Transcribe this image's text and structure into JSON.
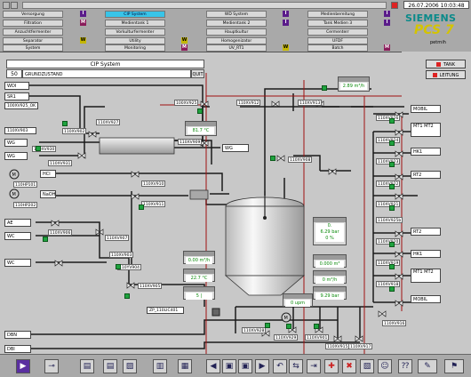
{
  "nav": {
    "rows": [
      [
        "Versorgung",
        "CIP System",
        "WD System",
        "Medienbereitung"
      ],
      [
        "Filtration",
        "Medientank 1",
        "Medientank 2",
        "Tank Medien 3"
      ],
      [
        "Anzuchtfermenter",
        "Vorkulturfermenter",
        "Hauptkultur",
        "Cermenterr"
      ],
      [
        "Separator",
        "Utility",
        "Homogenizator",
        "UFDF"
      ],
      [
        "System",
        "Monitoring",
        "UV_RT1",
        "Batch"
      ]
    ]
  },
  "header": {
    "datetime": "26.07.2006 10:03:48",
    "brand": "SIEMENS",
    "product": "PCS 7",
    "user": "petrnih"
  },
  "title": "CIP System",
  "state": {
    "num": "50",
    "text": "GRUNDZUSTAND",
    "quit": "QUIT"
  },
  "buttons": {
    "tank": "TANK",
    "leitung": "LEITUNG"
  },
  "left_tags": {
    "wdi": "WDI",
    "sr1": "SR1",
    "valve_ok": "100XV925_OK",
    "v903": "110XV903",
    "wg1": "WG",
    "wg2": "WG",
    "hcl": "HCl",
    "naoh": "NaOH",
    "ae": "AE",
    "wc1": "WC",
    "wc2": "WC",
    "dbn": "DBN",
    "dbi": "DBI",
    "wg_out": "WG",
    "zp": "ZP_110LIC401"
  },
  "right_tags": {
    "mobil1": "MOBIL",
    "mt12a": "MT1 MT2",
    "hk1": "HK1",
    "rt2a": "RT2",
    "rt2b": "RT2",
    "hk1b": "HK1",
    "mt12b": "MT1 MT2",
    "mobil2": "MOBIL"
  },
  "valves": [
    "100XV925",
    "110XV912",
    "110XV913",
    "110XV902",
    "110XV909",
    "110XV930",
    "110XV931",
    "110XV908",
    "110XV910",
    "110XV911",
    "110XV906",
    "110XV907",
    "110XV905",
    "110XV903",
    "110XV926",
    "110XV924",
    "110XV923",
    "110XV922",
    "110XV921",
    "110XV920",
    "110XV919",
    "110XV918",
    "110XV916",
    "110XV928",
    "110XV929",
    "110XV901",
    "110XV915",
    "110XV917",
    "110XV927",
    "110XV925b",
    "110YV904",
    "110HP101",
    "110HP202"
  ],
  "measurements": {
    "m1": "2.89 m³/h",
    "m2": "81.7 °C",
    "m3": "0.",
    "m4": "6.29 bar",
    "m5": "0 %",
    "m6": "0.000 m³",
    "m7": "0 m³/h",
    "m8": "9.29 bar",
    "m9": "0.00 m³/h",
    "m10": "22.7 °C",
    "m11": "5 |",
    "m12": "0 upm"
  },
  "colors": {
    "accent": "#38c4e8",
    "valve_green": "#1fa33f",
    "pipe": "#1a1a1a",
    "pipe_red": "#a01010"
  }
}
